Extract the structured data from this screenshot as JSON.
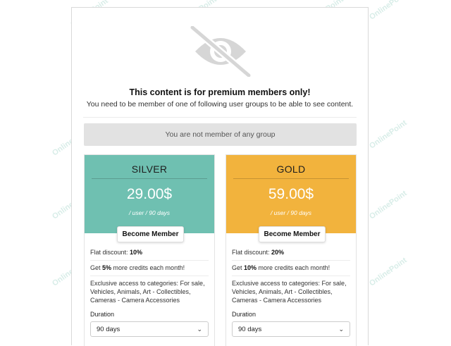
{
  "watermark_text": "OnlinePoint",
  "notice": {
    "title": "This content is for premium members only!",
    "subtitle": "You need to be member of one of following user groups to be able to see content.",
    "group_status": "You are not member of any group"
  },
  "plans": [
    {
      "name": "SILVER",
      "price": "29.00$",
      "period": "/ user / 90 days",
      "button": "Become Member",
      "color": "#6fc0b1",
      "discount_label": "Flat discount: ",
      "discount_value": "10%",
      "credits_prefix": "Get ",
      "credits_value": "5%",
      "credits_suffix": " more credits each month!",
      "access": "Exclusive access to categories: For sale, Vehicles, Animals, Art - Collectibles, Cameras - Camera Accessories",
      "duration_label": "Duration",
      "duration_value": "90 days"
    },
    {
      "name": "GOLD",
      "price": "59.00$",
      "period": "/ user / 90 days",
      "button": "Become Member",
      "color": "#f2b33d",
      "discount_label": "Flat discount: ",
      "discount_value": "20%",
      "credits_prefix": "Get ",
      "credits_value": "10%",
      "credits_suffix": " more credits each month!",
      "access": "Exclusive access to categories: For sale, Vehicles, Animals, Art - Collectibles, Cameras - Camera Accessories",
      "duration_label": "Duration",
      "duration_value": "90 days"
    }
  ]
}
